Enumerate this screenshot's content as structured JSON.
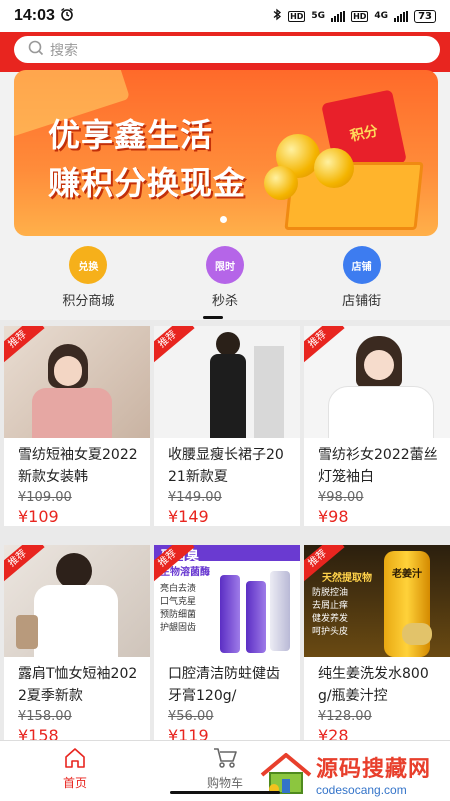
{
  "status": {
    "time": "14:03",
    "battery": "73",
    "net1": "5G",
    "net2": "4G"
  },
  "search": {
    "placeholder": "搜索"
  },
  "banner": {
    "line1": "优享鑫生活",
    "line2": "赚积分换现金",
    "card_text": "积分"
  },
  "quick": [
    {
      "label": "积分商城",
      "icon_text": "兑换",
      "color": "#f6b01a"
    },
    {
      "label": "秒杀",
      "icon_text": "限时",
      "color": "#b565e8"
    },
    {
      "label": "店铺街",
      "icon_text": "店铺",
      "color": "#3d7cf0"
    }
  ],
  "products": [
    {
      "title": "雪纺短袖女夏2022新款女装韩",
      "old": "¥109.00",
      "price": "¥109",
      "badge": "推荐"
    },
    {
      "title": "收腰显瘦长裙子2021新款夏",
      "old": "¥149.00",
      "price": "¥149",
      "badge": "推荐"
    },
    {
      "title": "雪纺衫女2022蕾丝灯笼袖白",
      "old": "¥98.00",
      "price": "¥98",
      "badge": "推荐"
    },
    {
      "title": "露肩T恤女短袖2022夏季新款",
      "old": "¥158.00",
      "price": "¥158",
      "badge": "推荐"
    },
    {
      "title": "口腔清洁防蛀健齿牙膏120g/",
      "old": "¥56.00",
      "price": "¥119",
      "badge": "推荐"
    },
    {
      "title": "纯生姜洗发水800g/瓶姜汁控",
      "old": "¥128.00",
      "price": "¥28",
      "badge": "推荐"
    }
  ],
  "product_art": {
    "toothpaste": [
      "亮白去渍",
      "口气克星",
      "预防细菌",
      "护龈固齿"
    ],
    "toothpaste_head": "牙口臭",
    "toothpaste_sub": "生物溶菌酶",
    "ginger": [
      "防脱控油",
      "去屑止痒",
      "健发养发",
      "呵护头皮"
    ],
    "ginger_head": "天然提取物",
    "ginger_bottle": "老姜汁"
  },
  "tabs": [
    {
      "label": "首页",
      "active": true
    },
    {
      "label": "购物车",
      "active": false
    }
  ],
  "watermark": {
    "cn": "源码搜藏网",
    "en": "codesocang.com"
  },
  "colors": {
    "brand": "#e8251f"
  }
}
